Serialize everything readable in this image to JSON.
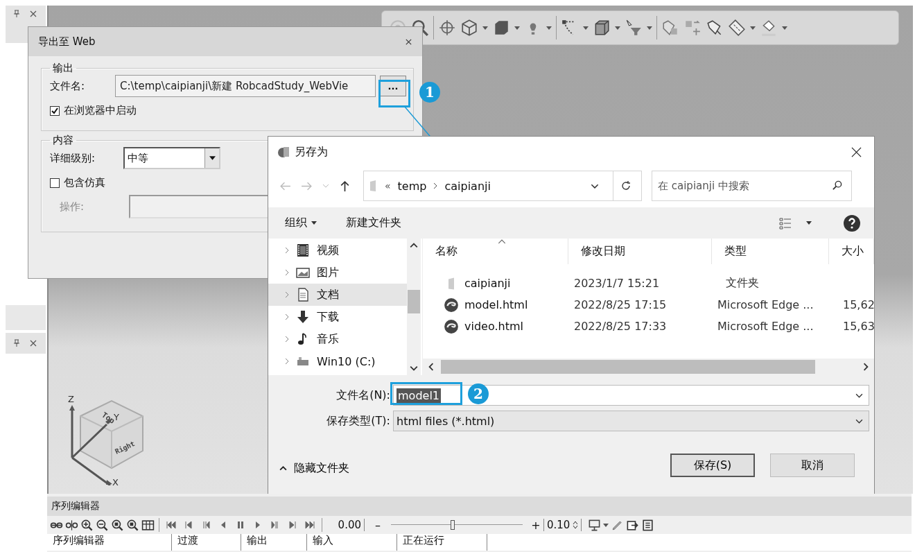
{
  "export_dialog": {
    "title": "导出至 Web",
    "output_group": {
      "legend": "输出",
      "filename_label": "文件名:",
      "filename_value": "C:\\temp\\caipianji\\新建 RobcadStudy_WebVie",
      "browse_button": "...",
      "launch": {
        "label": "在浏览器中启动",
        "checked": true
      }
    },
    "content_group": {
      "legend": "内容",
      "detail_label": "详细级别:",
      "detail_value": "中等",
      "simulation": {
        "label": "包含仿真",
        "checked": false
      },
      "operation_label": "操作:",
      "operation_disabled": true
    }
  },
  "callouts": [
    {
      "number": "1"
    },
    {
      "number": "2"
    }
  ],
  "save_dialog": {
    "title": "另存为",
    "overflow": "«",
    "breadcrumbs": [
      "temp",
      "caipianji"
    ],
    "search_placeholder": "在 caipianji 中搜索",
    "organize": "组织",
    "new_folder": "新建文件夹",
    "nav_items": [
      {
        "label": "视频",
        "kind": "video",
        "selected": false
      },
      {
        "label": "图片",
        "kind": "picture",
        "selected": false
      },
      {
        "label": "文档",
        "kind": "document",
        "selected": true
      },
      {
        "label": "下载",
        "kind": "download",
        "selected": false
      },
      {
        "label": "音乐",
        "kind": "music",
        "selected": false
      },
      {
        "label": "Win10 (C:)",
        "kind": "drive",
        "selected": false
      }
    ],
    "columns": [
      "名称",
      "修改日期",
      "类型",
      "大小"
    ],
    "files": [
      {
        "name": "caipianji",
        "modified": "2023/1/7 15:21",
        "type": "文件夹",
        "kind": "folder"
      },
      {
        "name": "model.html",
        "modified": "2022/8/25 17:15",
        "type": "Microsoft Edge ...",
        "size": "15,62",
        "kind": "edge"
      },
      {
        "name": "video.html",
        "modified": "2022/8/25 17:33",
        "type": "Microsoft Edge ...",
        "size": "15,63",
        "kind": "edge"
      }
    ],
    "filename_label": "文件名(N):",
    "filename_value": "model1",
    "filename_text_selected": true,
    "filetype_label": "保存类型(T):",
    "filetype_value": "html files (*.html)",
    "hide_folders": "隐藏文件夹",
    "save_button": "保存(S)",
    "cancel_button": "取消"
  },
  "viewcube": {
    "axes": [
      "Z",
      "Y",
      "X"
    ],
    "faces": [
      "Top",
      "Right"
    ]
  },
  "sequence_editor": {
    "title": "序列编辑器",
    "time": "0.00",
    "minus": "–",
    "plus": "+",
    "slider": {
      "level": 0.47
    },
    "step": "0.10",
    "columns": [
      "序列编辑器",
      "过渡",
      "输出",
      "输入",
      "正在运行"
    ]
  }
}
